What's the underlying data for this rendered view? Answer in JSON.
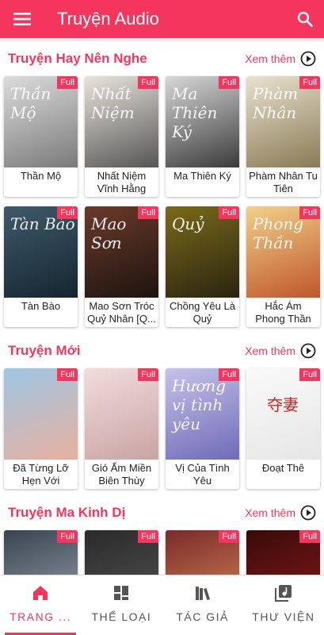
{
  "app": {
    "title": "Truyện Audio",
    "accent": "#f4365f"
  },
  "sections": [
    {
      "title": "Truyện Hay Nên Nghe",
      "see_more": "Xem thêm",
      "books": [
        {
          "name": "Thần Mộ",
          "badge": "Full",
          "cover_text": "Thần Mộ",
          "colors": [
            "#dcdcdc",
            "#7a7a7a"
          ]
        },
        {
          "name": "Nhất Niệm Vĩnh Hằng",
          "badge": "Full",
          "cover_text": "Nhất Niệm",
          "colors": [
            "#e8e4dc",
            "#555"
          ]
        },
        {
          "name": "Ma Thiên Ký",
          "badge": "Full",
          "cover_text": "Ma Thiên Ký",
          "colors": [
            "#d8d8d8",
            "#3a3a3a"
          ]
        },
        {
          "name": "Phàm Nhân Tu Tiên",
          "badge": "Full",
          "cover_text": "Phàm Nhân",
          "colors": [
            "#e9e2cf",
            "#8a7a55"
          ]
        },
        {
          "name": "Tàn Bào",
          "badge": "Full",
          "cover_text": "Tàn Bào",
          "colors": [
            "#3f5a6a",
            "#152530"
          ]
        },
        {
          "name": "Mao Sơn Tróc Quỷ Nhân [Q...",
          "badge": "Full",
          "cover_text": "Mao Sơn",
          "colors": [
            "#6a3a2a",
            "#1e1410"
          ]
        },
        {
          "name": "Chồng Yêu Là Quỷ",
          "badge": "Full",
          "cover_text": "Quỷ",
          "colors": [
            "#7a6a1a",
            "#2a2410"
          ]
        },
        {
          "name": "Hắc Ám Phong Thần Ký",
          "badge": "Full",
          "cover_text": "Phong Thần",
          "colors": [
            "#f1d18a",
            "#c0562a"
          ]
        }
      ]
    },
    {
      "title": "Truyện Mới",
      "see_more": "Xem thêm",
      "books": [
        {
          "name": "Đã Từng Lỡ Hẹn Với Than...",
          "badge": "Full",
          "cover_text": "",
          "colors": [
            "#9ec6e4",
            "#e8b0a0"
          ]
        },
        {
          "name": "Gió Ấm Miền Biên Thùy",
          "badge": "Full",
          "cover_text": "",
          "colors": [
            "#f2dcdc",
            "#c9a4a4"
          ]
        },
        {
          "name": "Vị Của Tình Yêu",
          "badge": "Full",
          "cover_text": "Hương vị tình yêu",
          "colors": [
            "#c6c2ea",
            "#6f6bb8"
          ]
        },
        {
          "name": "Đoạt Thê",
          "badge": "Full",
          "cover_text": "夺妻",
          "colors": [
            "#fafafa",
            "#e6e6e6"
          ]
        }
      ]
    },
    {
      "title": "Truyện Ma Kinh Dị",
      "see_more": "Xem thêm",
      "books": [
        {
          "name": "",
          "badge": "Full",
          "cover_text": "",
          "colors": [
            "#3a4450",
            "#9aa3ad"
          ]
        },
        {
          "name": "",
          "badge": "Full",
          "cover_text": "",
          "colors": [
            "#2a2a2a",
            "#555"
          ]
        },
        {
          "name": "",
          "badge": "Full",
          "cover_text": "",
          "colors": [
            "#7a2a2a",
            "#d98a5a"
          ]
        },
        {
          "name": "",
          "badge": "Full",
          "cover_text": "",
          "colors": [
            "#3a0a0a",
            "#8a1a1a"
          ]
        }
      ]
    }
  ],
  "bottom_nav": [
    {
      "label": "TRANG ...",
      "icon": "home-icon",
      "active": true
    },
    {
      "label": "THỂ LOẠI",
      "icon": "grid-icon",
      "active": false
    },
    {
      "label": "TÁC GIẢ",
      "icon": "books-icon",
      "active": false
    },
    {
      "label": "THƯ VIỆN",
      "icon": "library-icon",
      "active": false
    }
  ]
}
